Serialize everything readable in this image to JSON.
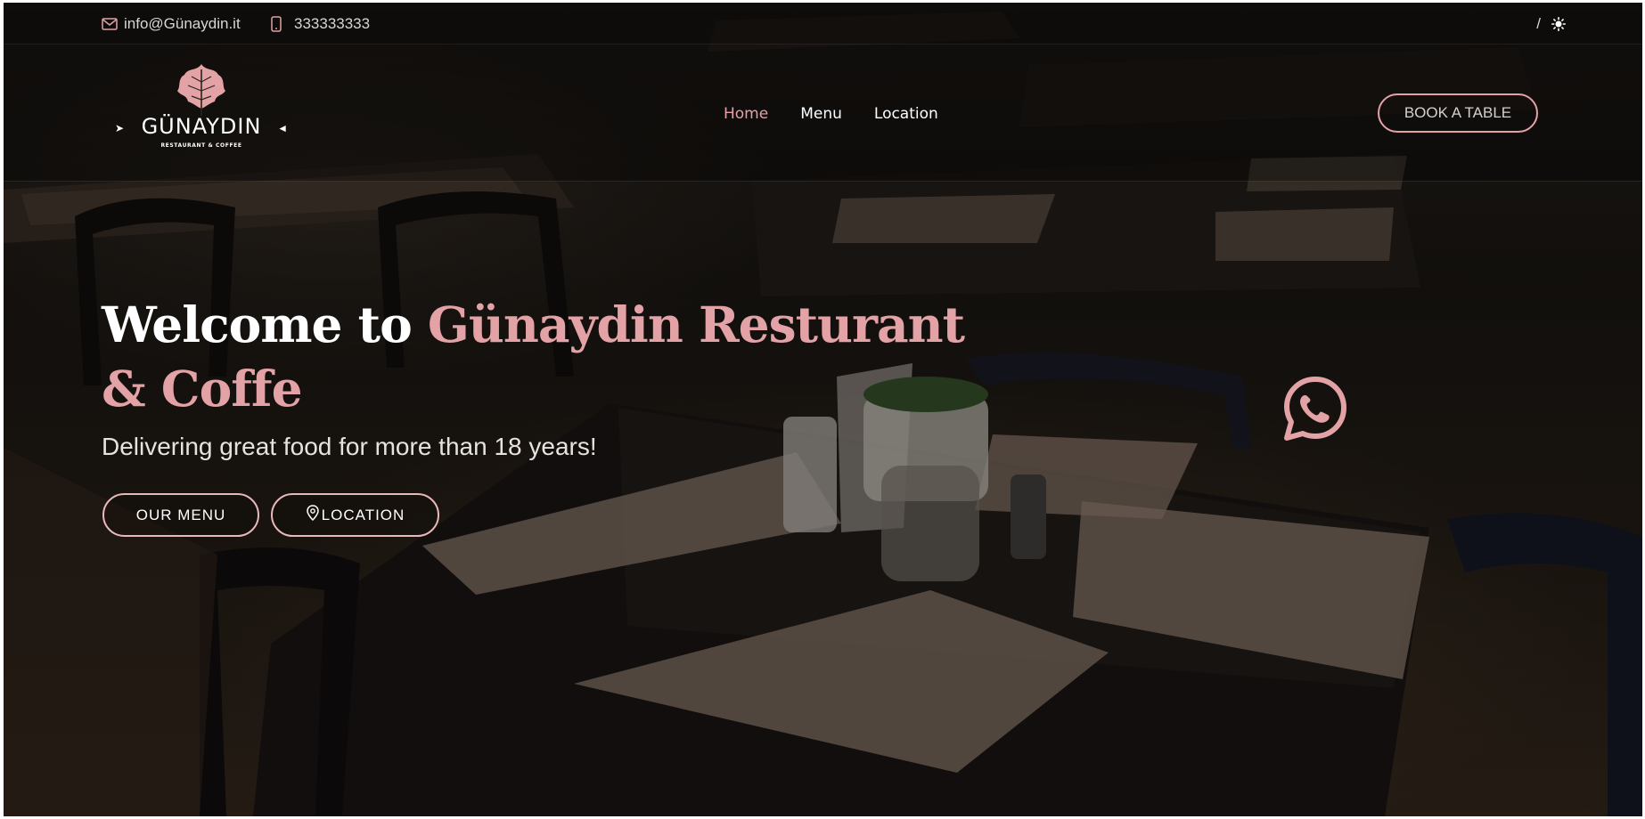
{
  "topbar": {
    "email": "info@Günaydin.it",
    "phone": "333333333",
    "theme_separator": "/"
  },
  "brand": {
    "name": "GÜNAYDIN",
    "tagline": "RESTAURANT & COFFEE"
  },
  "nav": {
    "items": [
      {
        "label": "Home",
        "active": true
      },
      {
        "label": "Menu",
        "active": false
      },
      {
        "label": "Location",
        "active": false
      }
    ],
    "book_label": "BOOK A TABLE"
  },
  "hero": {
    "title_plain": "Welcome to ",
    "title_accent": "Günaydin Resturant & Coffe",
    "subtitle": "Delivering great food for more than 18 years!",
    "menu_button": "OUR MENU",
    "location_button": "LOCATION"
  },
  "icons": {
    "email": "envelope-icon",
    "phone": "mobile-phone-icon",
    "theme": "sun-icon",
    "location": "map-pin-icon",
    "whatsapp": "whatsapp-icon",
    "logo": "leaf-icon"
  },
  "colors": {
    "accent": "#e3a2a5",
    "text_light": "#ffffff",
    "background_overlay": "#000000"
  }
}
